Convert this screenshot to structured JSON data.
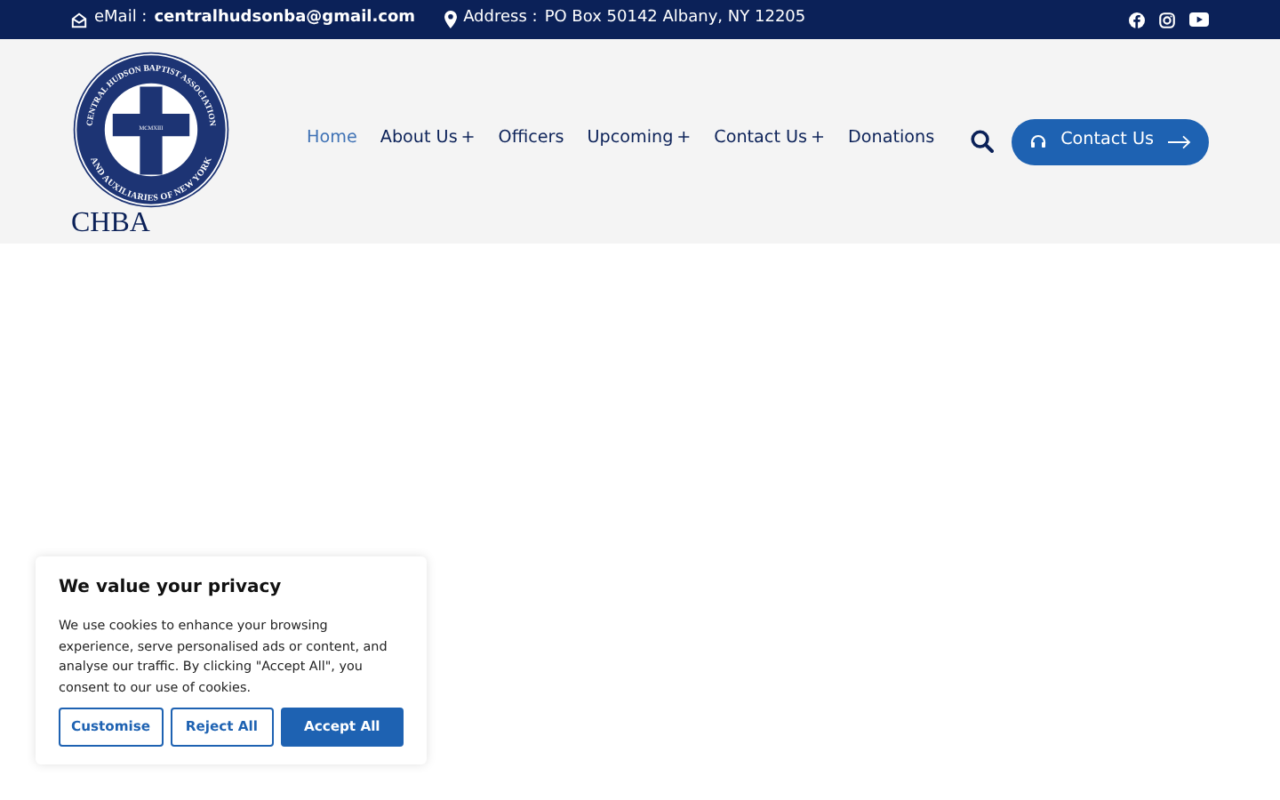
{
  "top_bar": {
    "email_label": "eMail :",
    "email": "centralhudsonba@gmail.com",
    "address_label": "Address :",
    "address": "PO Box 50142 Albany, NY 12205"
  },
  "logo": {
    "ring_top": "CENTRAL HUDSON BAPTIST ASSOCIATION",
    "ring_bottom": "AND AUXILIARIES OF NEW YORK",
    "year": "MCMXIII",
    "text": "CHBA"
  },
  "nav": [
    {
      "label": "Home",
      "selected": true
    },
    {
      "label": "About Us",
      "submenu": "+",
      "selected": false
    },
    {
      "label": "Officers",
      "selected": false
    },
    {
      "label": "Upcoming",
      "submenu": "+",
      "selected": false
    },
    {
      "label": "Contact Us",
      "submenu": "+",
      "selected": false
    },
    {
      "label": "Donations",
      "selected": false
    }
  ],
  "contact_button": "Contact Us",
  "cookie": {
    "title": "We value your privacy",
    "text": "We use cookies to enhance your browsing experience, serve personalised ads or content, and analyse our traffic. By clicking \"Accept All\", you consent to our use of cookies.",
    "buttons": [
      {
        "label": "Customise",
        "kind": "outline"
      },
      {
        "label": "Reject All",
        "kind": "outline"
      },
      {
        "label": "Accept All",
        "kind": "primary"
      }
    ]
  }
}
